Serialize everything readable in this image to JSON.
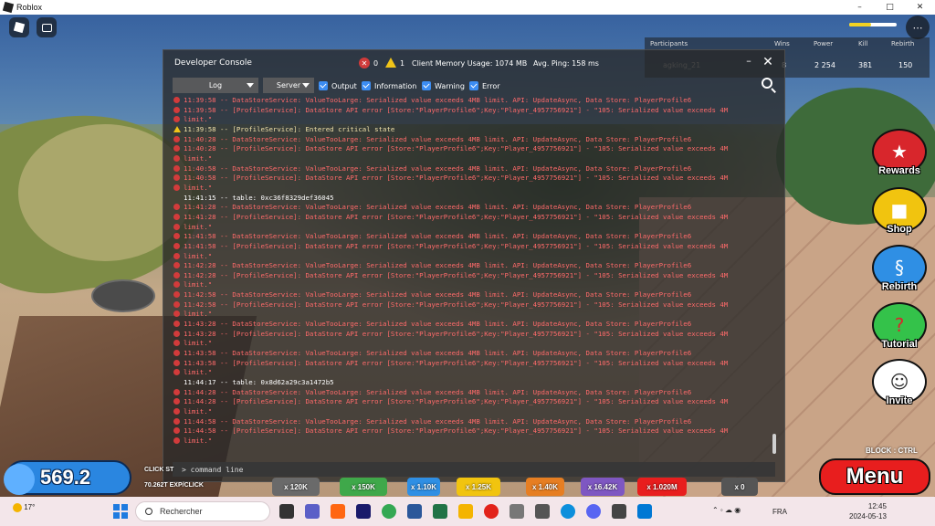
{
  "window": {
    "title": "Roblox",
    "controls": [
      "–",
      "□",
      "✕"
    ]
  },
  "leaderboard": {
    "headers": [
      "Participants",
      "Wins",
      "Power",
      "Kill",
      "Rebirth"
    ],
    "player": "agking_21",
    "values": {
      "wins": "8",
      "power": "2 254",
      "kill": "381",
      "rebirth": "150"
    }
  },
  "console": {
    "title": "Developer Console",
    "error_count": "0",
    "warning_count": "1",
    "memory": "Client Memory Usage: 1074 MB",
    "ping": "Avg. Ping: 158 ms",
    "log_dropdown": "Log",
    "server_dropdown": "Server",
    "filters": {
      "output": "Output",
      "information": "Information",
      "warning": "Warning",
      "error": "Error"
    },
    "command_placeholder": "> command line",
    "entries": [
      {
        "level": "err",
        "text": "11:39:58 -- DataStoreService: ValueTooLarge: Serialized value exceeds 4MB limit. API: UpdateAsync, Data Store: PlayerProfile6"
      },
      {
        "level": "err",
        "text": "11:39:58 -- [ProfileService]: DataStore API error [Store:\"PlayerProfile6\";Key:\"Player_4957756921\"] - \"105: Serialized value exceeds 4M"
      },
      {
        "level": "err",
        "text": "limit.\""
      },
      {
        "level": "warn",
        "text": "11:39:58 -- [ProfileService]: Entered critical state"
      },
      {
        "level": "err",
        "text": "11:40:28 -- DataStoreService: ValueTooLarge: Serialized value exceeds 4MB limit. API: UpdateAsync, Data Store: PlayerProfile6"
      },
      {
        "level": "err",
        "text": "11:40:28 -- [ProfileService]: DataStore API error [Store:\"PlayerProfile6\";Key:\"Player_4957756921\"] - \"105: Serialized value exceeds 4M"
      },
      {
        "level": "err",
        "text": "limit.\""
      },
      {
        "level": "err",
        "text": "11:40:58 -- DataStoreService: ValueTooLarge: Serialized value exceeds 4MB limit. API: UpdateAsync, Data Store: PlayerProfile6"
      },
      {
        "level": "err",
        "text": "11:40:58 -- [ProfileService]: DataStore API error [Store:\"PlayerProfile6\";Key:\"Player_4957756921\"] - \"105: Serialized value exceeds 4M"
      },
      {
        "level": "err",
        "text": "limit.\""
      },
      {
        "level": "info",
        "text": "11:41:15 -- table: 0xc36f8329def36045"
      },
      {
        "level": "err",
        "text": "11:41:28 -- DataStoreService: ValueTooLarge: Serialized value exceeds 4MB limit. API: UpdateAsync, Data Store: PlayerProfile6"
      },
      {
        "level": "err",
        "text": "11:41:28 -- [ProfileService]: DataStore API error [Store:\"PlayerProfile6\";Key:\"Player_4957756921\"] - \"105: Serialized value exceeds 4M"
      },
      {
        "level": "err",
        "text": "limit.\""
      },
      {
        "level": "err",
        "text": "11:41:58 -- DataStoreService: ValueTooLarge: Serialized value exceeds 4MB limit. API: UpdateAsync, Data Store: PlayerProfile6"
      },
      {
        "level": "err",
        "text": "11:41:58 -- [ProfileService]: DataStore API error [Store:\"PlayerProfile6\";Key:\"Player_4957756921\"] - \"105: Serialized value exceeds 4M"
      },
      {
        "level": "err",
        "text": "limit.\""
      },
      {
        "level": "err",
        "text": "11:42:28 -- DataStoreService: ValueTooLarge: Serialized value exceeds 4MB limit. API: UpdateAsync, Data Store: PlayerProfile6"
      },
      {
        "level": "err",
        "text": "11:42:28 -- [ProfileService]: DataStore API error [Store:\"PlayerProfile6\";Key:\"Player_4957756921\"] - \"105: Serialized value exceeds 4M"
      },
      {
        "level": "err",
        "text": "limit.\""
      },
      {
        "level": "err",
        "text": "11:42:58 -- DataStoreService: ValueTooLarge: Serialized value exceeds 4MB limit. API: UpdateAsync, Data Store: PlayerProfile6"
      },
      {
        "level": "err",
        "text": "11:42:58 -- [ProfileService]: DataStore API error [Store:\"PlayerProfile6\";Key:\"Player_4957756921\"] - \"105: Serialized value exceeds 4M"
      },
      {
        "level": "err",
        "text": "limit.\""
      },
      {
        "level": "err",
        "text": "11:43:28 -- DataStoreService: ValueTooLarge: Serialized value exceeds 4MB limit. API: UpdateAsync, Data Store: PlayerProfile6"
      },
      {
        "level": "err",
        "text": "11:43:28 -- [ProfileService]: DataStore API error [Store:\"PlayerProfile6\";Key:\"Player_4957756921\"] - \"105: Serialized value exceeds 4M"
      },
      {
        "level": "err",
        "text": "limit.\""
      },
      {
        "level": "err",
        "text": "11:43:58 -- DataStoreService: ValueTooLarge: Serialized value exceeds 4MB limit. API: UpdateAsync, Data Store: PlayerProfile6"
      },
      {
        "level": "err",
        "text": "11:43:58 -- [ProfileService]: DataStore API error [Store:\"PlayerProfile6\";Key:\"Player_4957756921\"] - \"105: Serialized value exceeds 4M"
      },
      {
        "level": "err",
        "text": "limit.\""
      },
      {
        "level": "info",
        "text": "11:44:17 -- table: 0x8d62a29c3a1472b5"
      },
      {
        "level": "err",
        "text": "11:44:28 -- DataStoreService: ValueTooLarge: Serialized value exceeds 4MB limit. API: UpdateAsync, Data Store: PlayerProfile6"
      },
      {
        "level": "err",
        "text": "11:44:28 -- [ProfileService]: DataStore API error [Store:\"PlayerProfile6\";Key:\"Player_4957756921\"] - \"105: Serialized value exceeds 4M"
      },
      {
        "level": "err",
        "text": "limit.\""
      },
      {
        "level": "err",
        "text": "11:44:58 -- DataStoreService: ValueTooLarge: Serialized value exceeds 4MB limit. API: UpdateAsync, Data Store: PlayerProfile6"
      },
      {
        "level": "err",
        "text": "11:44:58 -- [ProfileService]: DataStore API error [Store:\"PlayerProfile6\";Key:\"Player_4957756921\"] - \"105: Serialized value exceeds 4M"
      },
      {
        "level": "err",
        "text": "limit.\""
      }
    ]
  },
  "side_menu": {
    "rewards": "Rewards",
    "shop": "Shop",
    "rebirth": "Rebirth",
    "tutorial": "Tutorial",
    "invite": "Invite"
  },
  "hud": {
    "power_value": "569.2",
    "click_label": "CLICK ST",
    "exp_label": "70.262T EXP/CLICK",
    "block_hint": "BLOCK : CTRL",
    "menu_label": "Menu",
    "boosts": [
      "x 120K",
      "x 150K",
      "x 1.10K",
      "x 1.25K",
      "x 1.40K",
      "x 16.42K",
      "x 1.020M",
      "x 0"
    ]
  },
  "taskbar": {
    "weather": "17°",
    "search_placeholder": "Rechercher",
    "language": "FRA",
    "time": "12:45",
    "date": "2024-05-13"
  },
  "colors": {
    "error_text": "#ff6a6a",
    "checkbox": "#3c8df3",
    "menu_red": "#e81e1e",
    "power_blue": "#2a86e0"
  }
}
